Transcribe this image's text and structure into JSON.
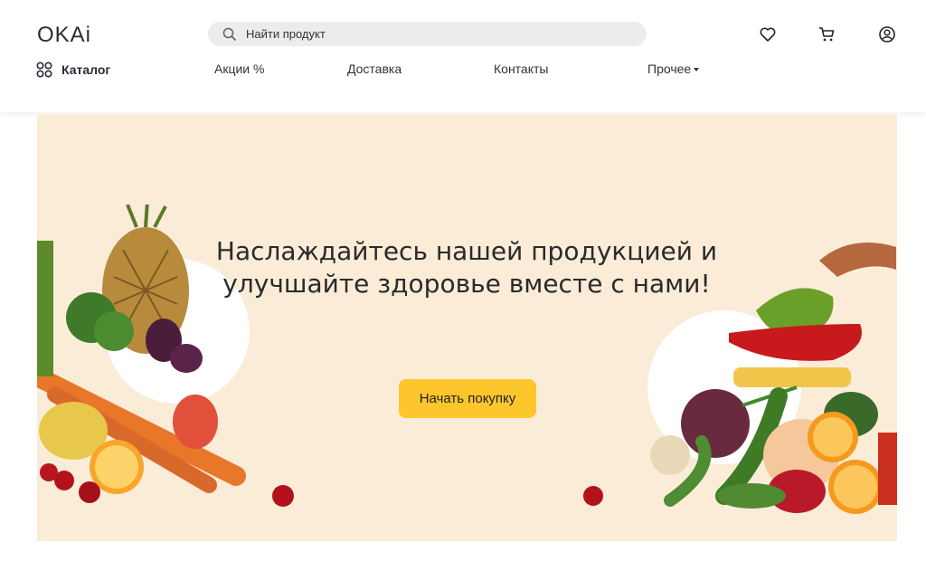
{
  "header": {
    "logo": "OKAi",
    "search": {
      "placeholder": "Найти продукт"
    },
    "icons": [
      "heart-icon",
      "cart-icon",
      "user-icon"
    ]
  },
  "nav": {
    "catalog": "Каталог",
    "items": [
      {
        "label": "Акции %"
      },
      {
        "label": "Доставка"
      },
      {
        "label": "Контакты"
      },
      {
        "label": "Прочее"
      }
    ]
  },
  "hero": {
    "title_line1": "Наслаждайтесь нашей продукцией и",
    "title_line2": "улучшайте здоровье вместе с нами!",
    "cta": "Начать покупку",
    "colors": {
      "background": "#fbecd8",
      "button": "#fdc62d"
    }
  }
}
